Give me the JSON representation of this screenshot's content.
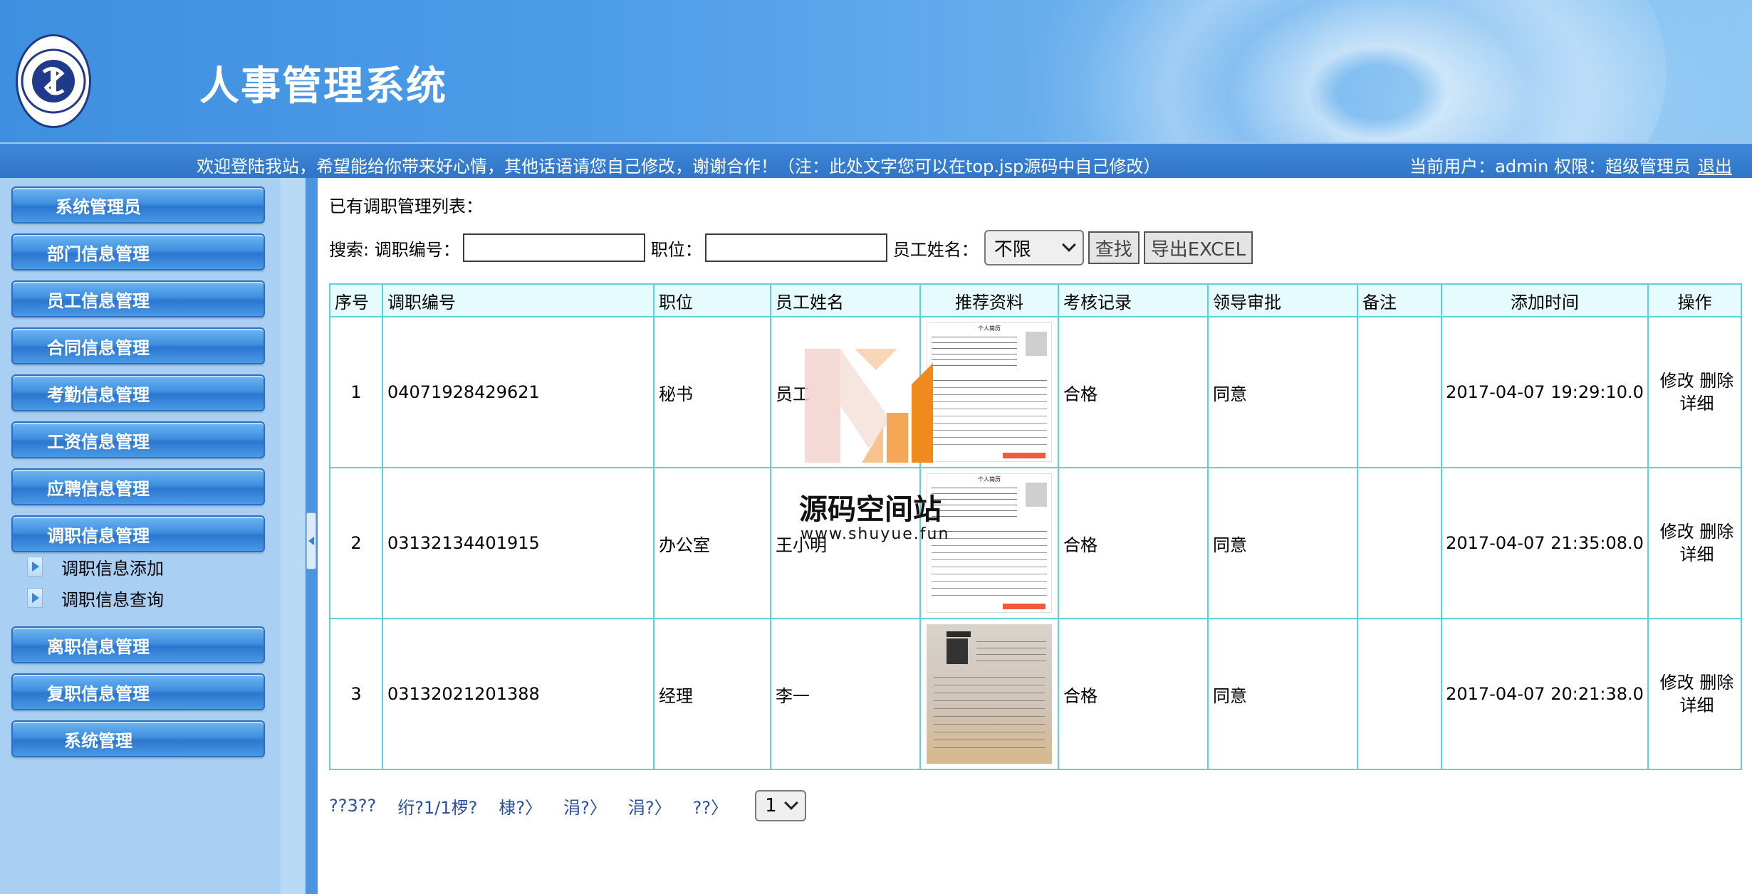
{
  "header": {
    "app_title": "人事管理系统",
    "welcome_text": "欢迎登陆我站，希望能给你带来好心情，其他话语请您自己修改，谢谢合作！（注：此处文字您可以在top.jsp源码中自己修改）",
    "user_info": "当前用户：admin 权限：超级管理员",
    "logout_label": "退出"
  },
  "sidebar": {
    "items": [
      {
        "label": "系统管理员"
      },
      {
        "label": "部门信息管理"
      },
      {
        "label": "员工信息管理"
      },
      {
        "label": "合同信息管理"
      },
      {
        "label": "考勤信息管理"
      },
      {
        "label": "工资信息管理"
      },
      {
        "label": "应聘信息管理"
      },
      {
        "label": "调职信息管理"
      },
      {
        "label": "离职信息管理"
      },
      {
        "label": "复职信息管理"
      },
      {
        "label": "系统管理"
      }
    ],
    "submenu": [
      {
        "label": "调职信息添加"
      },
      {
        "label": "调职信息查询"
      }
    ]
  },
  "main": {
    "list_title": "已有调职管理列表：",
    "search": {
      "prefix_label": "搜索: 调职编号：",
      "code_value": "",
      "position_label": "职位：",
      "position_value": "",
      "name_label": "员工姓名：",
      "name_selected": "不限",
      "search_button": "查找",
      "export_button": "导出EXCEL"
    },
    "table": {
      "columns": [
        "序号",
        "调职编号",
        "职位",
        "员工姓名",
        "推荐资料",
        "考核记录",
        "领导审批",
        "备注",
        "添加时间",
        "操作"
      ],
      "rows": [
        {
          "no": "1",
          "code": "04071928429621",
          "position": "秘书",
          "name": "员工",
          "assessment": "合格",
          "approval": "同意",
          "remark": "",
          "time": "2017-04-07 19:29:10.0"
        },
        {
          "no": "2",
          "code": "03132134401915",
          "position": "办公室",
          "name": "王小明",
          "assessment": "合格",
          "approval": "同意",
          "remark": "",
          "time": "2017-04-07 21:35:08.0"
        },
        {
          "no": "3",
          "code": "03132021201388",
          "position": "经理",
          "name": "李一",
          "assessment": "合格",
          "approval": "同意",
          "remark": "",
          "time": "2017-04-07 20:21:38.0"
        }
      ],
      "op_edit": "修改",
      "op_delete": "删除",
      "op_detail": "详细",
      "resume_title": "个人简历"
    },
    "pagination": {
      "items": [
        "??3??",
        "绗?1/1椤?",
        "棣?〉",
        "涓?〉",
        "涓?〉",
        "??〉"
      ],
      "page_selected": "1"
    }
  },
  "watermark": {
    "name": "源码空间站",
    "url": "www.shuyue.fun"
  },
  "colors": {
    "header_blue": "#3f8fe0",
    "sidebar_bg": "#a9d0f2",
    "table_border": "#5fd0d6",
    "table_header_bg": "#e5fbfd",
    "pagination_link": "#2a4fa0"
  }
}
